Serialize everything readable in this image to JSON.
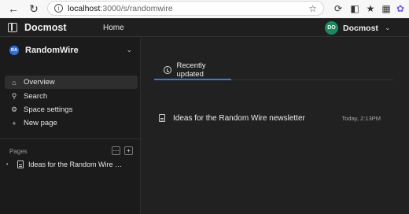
{
  "browser": {
    "url_host": "localhost",
    "url_path": ":3000/s/randomwire",
    "back_icon": "arrow-left-icon",
    "reload_icon": "reload-icon"
  },
  "header": {
    "app_name": "Docmost",
    "home_label": "Home",
    "user_initials": "DO",
    "user_name": "Docmost",
    "avatar_color": "#1a8a5c"
  },
  "sidebar": {
    "space_initials": "RA",
    "space_name": "RandomWire",
    "space_avatar_color": "#2f6fd6",
    "nav": [
      {
        "label": "Overview",
        "icon": "home-icon"
      },
      {
        "label": "Search",
        "icon": "search-icon"
      },
      {
        "label": "Space settings",
        "icon": "gear-icon"
      },
      {
        "label": "New page",
        "icon": "plus-icon"
      }
    ],
    "pages_label": "Pages",
    "pages": [
      {
        "title": "Ideas for the Random Wire newsletter"
      }
    ]
  },
  "main": {
    "tab_label": "Recently updated",
    "accent_color": "#3a78e0",
    "recent": [
      {
        "title": "Ideas for the Random Wire newsletter",
        "time": "Today, 2:13PM"
      }
    ]
  }
}
